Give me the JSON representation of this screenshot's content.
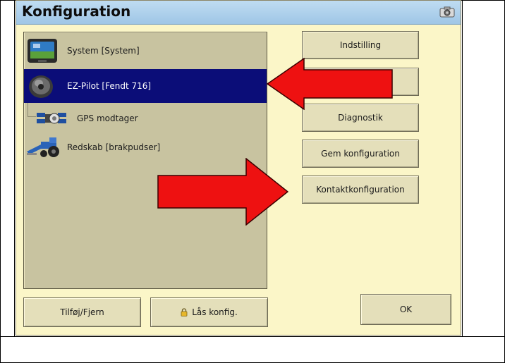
{
  "window": {
    "title": "Konfiguration"
  },
  "list": {
    "items": [
      {
        "label": "System [System]",
        "icon": "display-terminal-icon",
        "selected": false
      },
      {
        "label": "EZ-Pilot [Fendt 716]",
        "icon": "steering-motor-icon",
        "selected": true
      },
      {
        "label": "GPS modtager",
        "icon": "gps-receiver-icon",
        "selected": false
      },
      {
        "label": "Redskab [brakpudser]",
        "icon": "tractor-implement-icon",
        "selected": false
      }
    ]
  },
  "buttons": {
    "indstilling": "Indstilling",
    "blank": "",
    "diagnostik": "Diagnostik",
    "gem": "Gem konfiguration",
    "kontakt": "Kontaktkonfiguration",
    "tilfoj": "Tilføj/Fjern",
    "las": "Lås konfig.",
    "ok": "OK"
  },
  "colors": {
    "window_bg": "#fbf6c8",
    "titlebar": "#a8cdea",
    "list_bg": "#c8c3a0",
    "selected_bg": "#0b0d78",
    "arrow_red": "#ee1111"
  }
}
